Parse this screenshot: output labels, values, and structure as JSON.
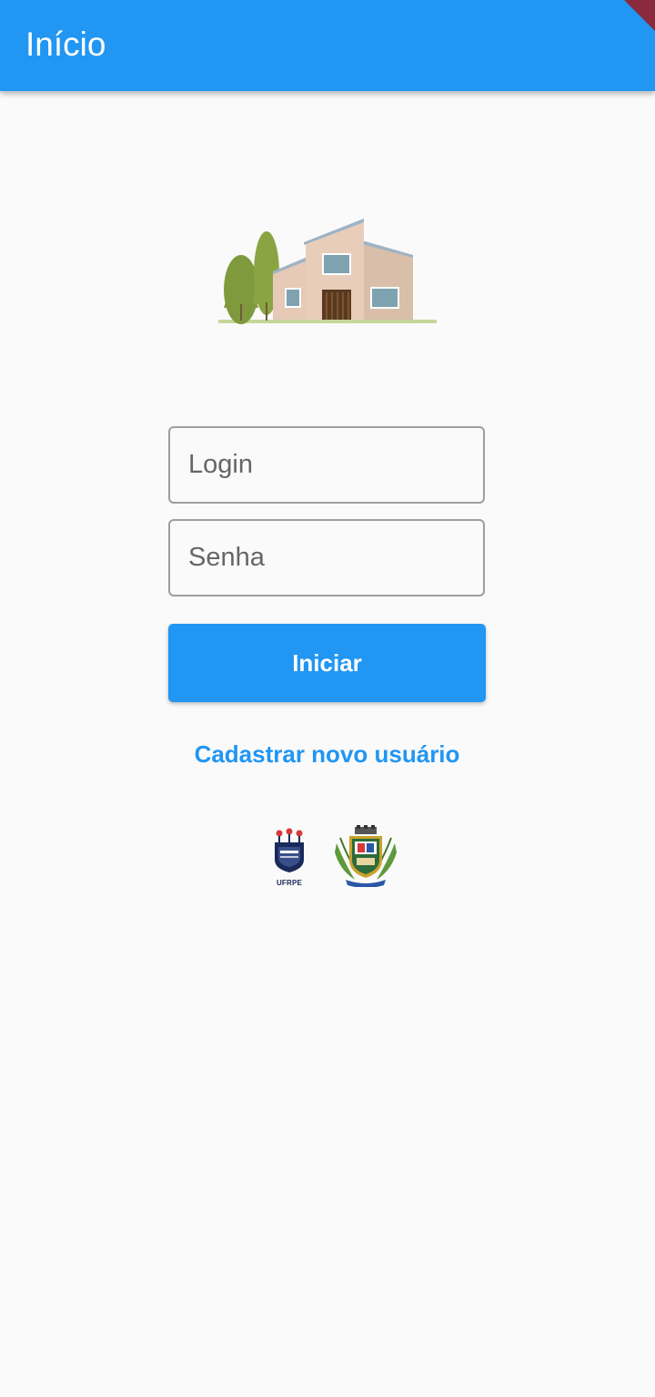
{
  "appbar": {
    "title": "Início"
  },
  "form": {
    "login_placeholder": "Login",
    "password_placeholder": "Senha",
    "submit_label": "Iniciar",
    "register_link": "Cadastrar novo usuário"
  },
  "footer": {
    "ufrpe_logo_text": "UFRPE"
  },
  "colors": {
    "primary": "#2196f3",
    "background": "#fafafa",
    "field_border": "#9e9e9e",
    "placeholder": "#666666"
  },
  "icons": {
    "app_logo": "house-with-trees-illustration",
    "ufrpe_logo": "ufrpe-emblem",
    "municipal_crest": "coat-of-arms"
  }
}
